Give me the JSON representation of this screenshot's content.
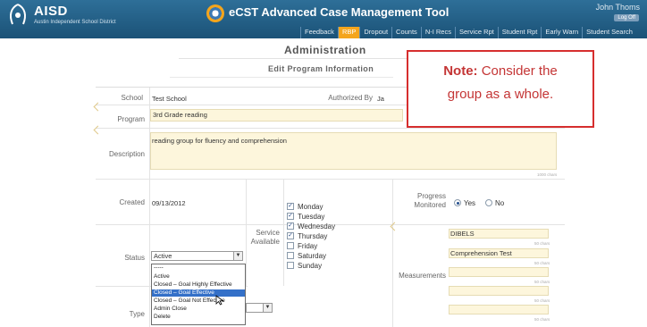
{
  "header": {
    "logo_title": "AISD",
    "logo_subtitle": "Austin Independent School District",
    "app_title": "eCST Advanced Case Management Tool",
    "user_name": "John Thoms",
    "logoff_label": "Log Off",
    "nav_items": [
      "Feedback",
      "RBP",
      "Dropout",
      "Counts",
      "N-I Recs",
      "Service Rpt",
      "Student Rpt",
      "Early Warn",
      "Student Search"
    ],
    "active_nav": "RBP"
  },
  "page": {
    "title": "Administration",
    "subtitle": "Edit Program Information"
  },
  "note": {
    "bold": "Note:",
    "line1_rest": " Consider the",
    "line2": "group as a whole."
  },
  "form": {
    "school_label": "School",
    "school_value": "Test School",
    "authorized_label": "Authorized By",
    "authorized_value": "Ja",
    "program_label": "Program",
    "program_value": "3rd Grade reading",
    "description_label": "Description",
    "description_value": "reading group for fluency and comprehension",
    "description_chars": "1000 chars",
    "created_label": "Created",
    "created_value": "09/13/2012",
    "service_label_1": "Service",
    "service_label_2": "Available",
    "days": [
      {
        "label": "Monday",
        "checked": true
      },
      {
        "label": "Tuesday",
        "checked": true
      },
      {
        "label": "Wednesday",
        "checked": true
      },
      {
        "label": "Thursday",
        "checked": true
      },
      {
        "label": "Friday",
        "checked": false
      },
      {
        "label": "Saturday",
        "checked": false
      },
      {
        "label": "Sunday",
        "checked": false
      }
    ],
    "progress_label_1": "Progress",
    "progress_label_2": "Monitored",
    "progress_yes": "Yes",
    "progress_no": "No",
    "status_label": "Status",
    "status_value": "Active",
    "status_options": [
      "-----",
      "Active",
      "Closed – Goal Highly Effective",
      "Closed – Goal Effective",
      "Closed – Goal Not Effective",
      "Admin Close",
      "Delete"
    ],
    "status_highlighted": "Closed – Goal Effective",
    "measurements_label": "Measurements",
    "measurements": [
      "DIBELS",
      "Comprehension Test",
      "",
      "",
      ""
    ],
    "measure_chars": "50 chars",
    "type_label": "Type"
  }
}
